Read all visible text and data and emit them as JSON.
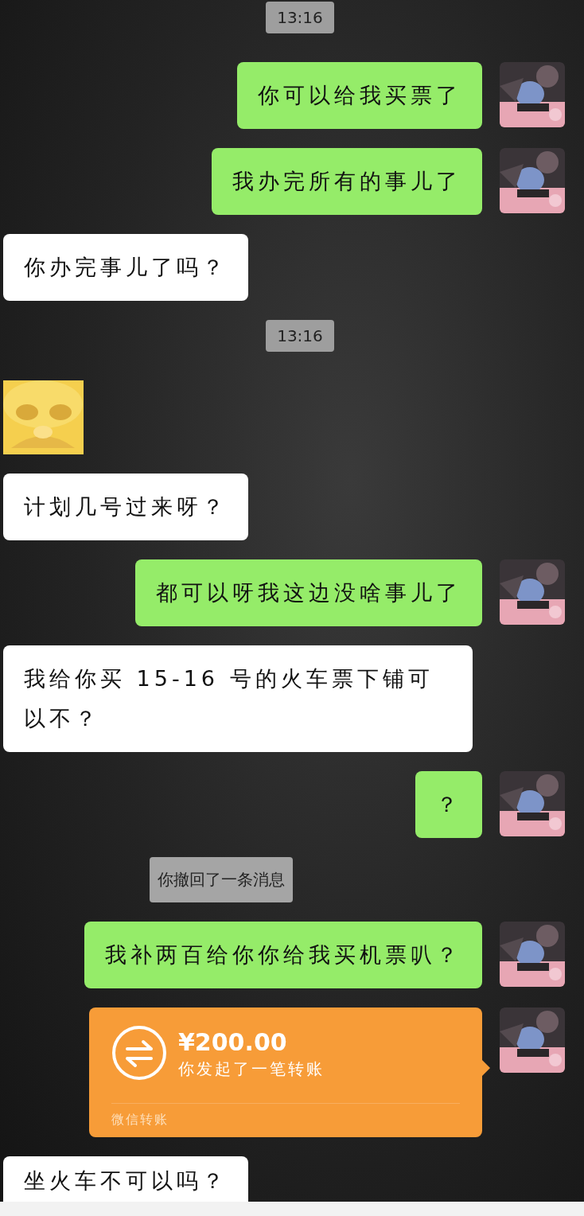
{
  "messages": [
    {
      "kind": "time",
      "text": "13:16"
    },
    {
      "kind": "text",
      "mine": true,
      "text": "你可以给我买票了"
    },
    {
      "kind": "text",
      "mine": true,
      "text": "我办完所有的事儿了"
    },
    {
      "kind": "text",
      "mine": false,
      "text": "你办完事儿了吗？"
    },
    {
      "kind": "time",
      "text": "13:16"
    },
    {
      "kind": "sticker",
      "mine": false
    },
    {
      "kind": "text",
      "mine": false,
      "text": "计划几号过来呀？"
    },
    {
      "kind": "text",
      "mine": true,
      "text": "都可以呀我这边没啥事儿了"
    },
    {
      "kind": "text",
      "mine": false,
      "text": "我给你买 15-16 号的火车票下铺可以不？"
    },
    {
      "kind": "text",
      "mine": true,
      "text": "？"
    },
    {
      "kind": "system",
      "text": "你撤回了一条消息"
    },
    {
      "kind": "text",
      "mine": true,
      "text": "我补两百给你你给我买机票叭？"
    },
    {
      "kind": "transfer",
      "mine": true,
      "amount": "¥200.00",
      "note": "你发起了一笔转账",
      "footer": "微信转账"
    },
    {
      "kind": "text",
      "mine": false,
      "text": "坐火车不可以吗？"
    }
  ]
}
